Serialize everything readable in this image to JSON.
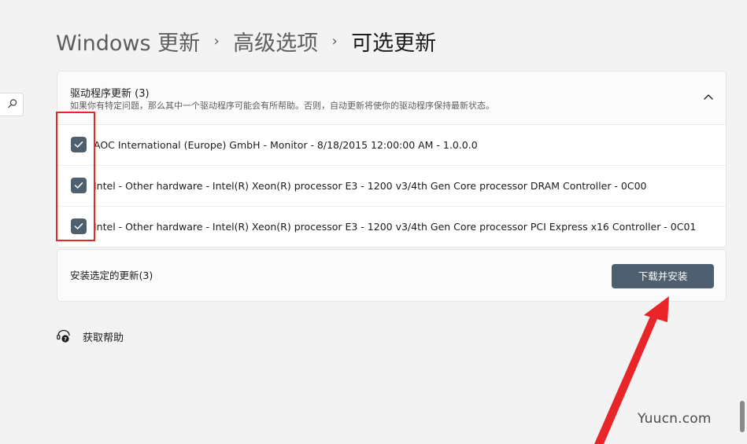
{
  "breadcrumb": {
    "items": [
      "Windows 更新",
      "高级选项"
    ],
    "current": "可选更新",
    "separator": "›"
  },
  "search": {
    "icon": "search-icon"
  },
  "driver_updates": {
    "title": "驱动程序更新 (3)",
    "description": "如果你有特定问题，那么其中一个驱动程序可能会有所帮助。否则，自动更新将使你的驱动程序保持最新状态。",
    "collapse_icon": "chevron-up-icon",
    "items": [
      {
        "label": "AOC International (Europe) GmbH - Monitor - 8/18/2015 12:00:00 AM - 1.0.0.0",
        "checked": true
      },
      {
        "label": "Intel - Other hardware - Intel(R) Xeon(R) processor E3 - 1200 v3/4th Gen Core processor DRAM Controller - 0C00",
        "checked": true
      },
      {
        "label": "Intel - Other hardware - Intel(R) Xeon(R) processor E3 - 1200 v3/4th Gen Core processor PCI Express x16 Controller - 0C01",
        "checked": true
      }
    ]
  },
  "install": {
    "label": "安装选定的更新(3)",
    "button_label": "下载并安装"
  },
  "help": {
    "label": "获取帮助",
    "icon": "help-icon"
  },
  "watermark": "Yuucn.com",
  "colors": {
    "accent": "#4e5f70",
    "annotation": "#e8262a",
    "background": "#f3f3f3"
  }
}
